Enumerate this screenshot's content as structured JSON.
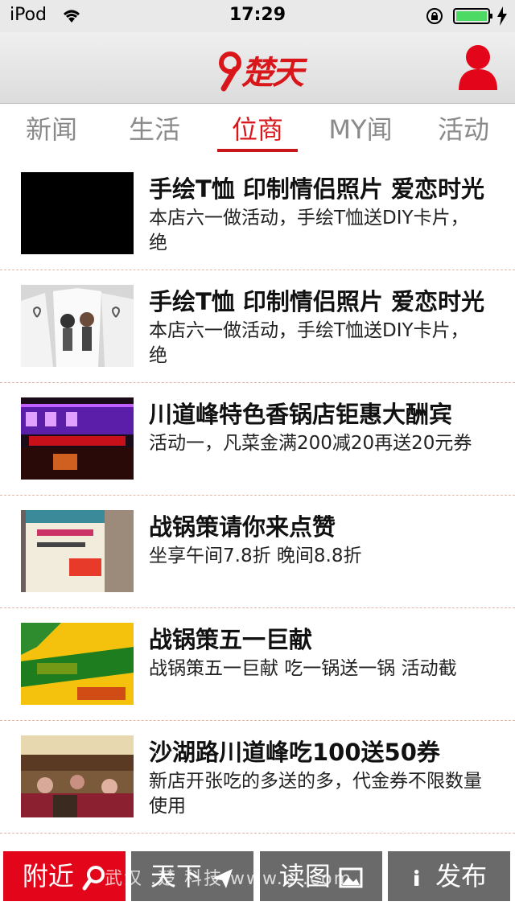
{
  "status_bar": {
    "carrier": "iPod",
    "time": "17:29"
  },
  "header": {
    "logo_text": "楚天"
  },
  "tabs": [
    {
      "label": "新闻",
      "active": false
    },
    {
      "label": "生活",
      "active": false
    },
    {
      "label": "位商",
      "active": true
    },
    {
      "label": "MY闻",
      "active": false
    },
    {
      "label": "活动",
      "active": false
    }
  ],
  "items": [
    {
      "title": "手绘T恤 印制情侣照片 爱恋时光",
      "desc": "本店六一做活动，手绘T恤送DIY卡片，绝",
      "thumb": "black"
    },
    {
      "title": "手绘T恤 印制情侣照片 爱恋时光",
      "desc": "本店六一做活动，手绘T恤送DIY卡片，绝",
      "thumb": "tshirt"
    },
    {
      "title": "川道峰特色香锅店钜惠大酬宾",
      "desc": "活动一，凡菜金满200减20再送20元券",
      "thumb": "storefront"
    },
    {
      "title": "战锅策请你来点赞",
      "desc": "坐享午间7.8折  晚间8.8折",
      "thumb": "poster"
    },
    {
      "title": "战锅策五一巨献",
      "desc": "战锅策五一巨献  吃一锅送一锅  活动截",
      "thumb": "promo"
    },
    {
      "title": "沙湖路川道峰吃100送50券",
      "desc": "新店开张吃的多送的多，代金券不限数量使用",
      "thumb": "restaurant"
    }
  ],
  "bottom_bar": [
    {
      "label": "附近",
      "icon": "search-icon",
      "active": true
    },
    {
      "label": "天下",
      "icon": "plane-icon",
      "active": false
    },
    {
      "label": "读图",
      "icon": "image-icon",
      "active": false
    },
    {
      "label": "发布",
      "icon": "info-icon",
      "active": false
    }
  ],
  "watermark": "武汉 .楚 科技 www.c      .com",
  "colors": {
    "accent": "#d9171a",
    "tab_inactive": "#8a8a8a",
    "bottom_bg": "#6a6a6a"
  }
}
